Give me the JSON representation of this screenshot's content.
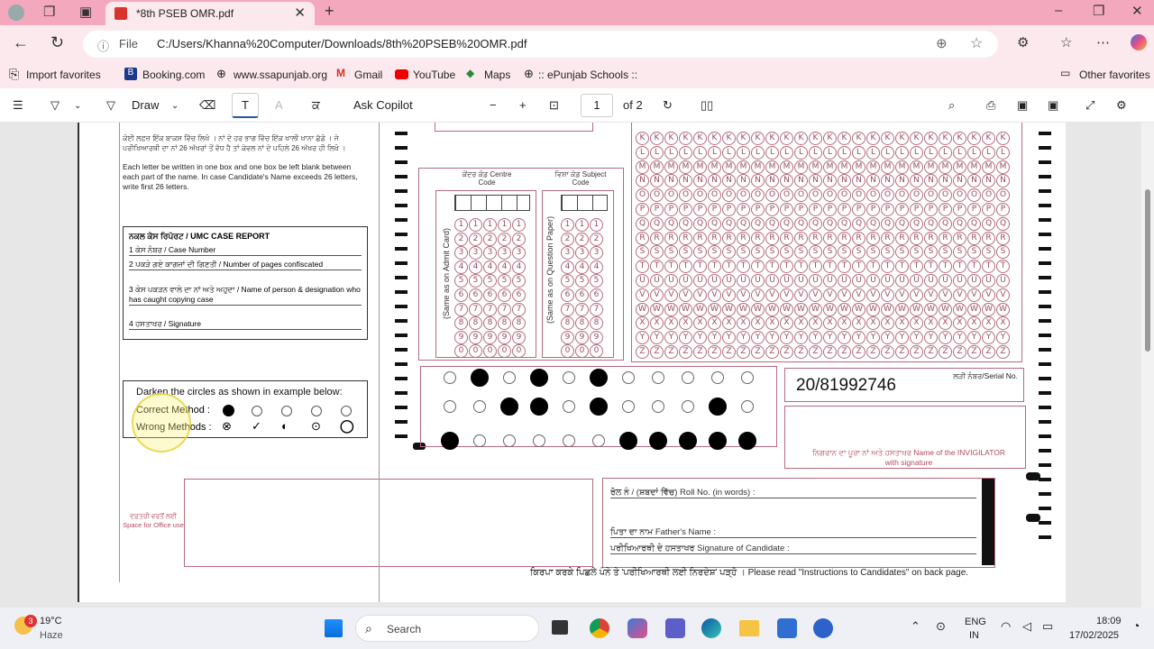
{
  "browser": {
    "tab_title": "*8th PSEB OMR.pdf",
    "url_label": "File",
    "url": "C:/Users/Khanna%20Computer/Downloads/8th%20PSEB%20OMR.pdf"
  },
  "bookmarks": [
    "Import favorites",
    "Booking.com",
    "www.ssapunjab.org",
    "Gmail",
    "YouTube",
    "Maps",
    ":: ePunjab Schools ::"
  ],
  "other_favorites": "Other favorites",
  "pdf_toolbar": {
    "draw": "Draw",
    "ask_copilot": "Ask Copilot",
    "page": "1",
    "of_pages": "of 2"
  },
  "omr": {
    "instr1": "ਕੋਈ ਲਫ਼ਜ਼ ਇੱਕ ਬਾਕਸ ਵਿੱਚ ਲਿਖੋ । ਨਾਂ ਦੇ ਹਰ ਭਾਗ ਵਿੱਚ ਇੱਕ ਖਾਲੀ ਖਾਨਾ ਛੱਡੋ । ਜੇ ਪਰੀਖਿਆਰਥੀ ਦਾ ਨਾਂ 26 ਅੱਖਰਾਂ ਤੋਂ ਵੱਧ ਹੈ ਤਾਂ ਕੇਵਲ ਨਾਂ ਦੇ ਪਹਿਲੇ 26 ਅੱਖਰ ਹੀ ਲਿਖੋ ।",
    "instr2": "Each letter be written in one box and one box be left blank between each part of the name. In case Candidate's Name exceeds 26 letters, write first 26 letters.",
    "umc_title": "ਨਕਲ ਕੇਸ ਰਿਪੋਰਟ / UMC CASE REPORT",
    "umc_items": [
      "1  ਕੇਸ ਨੰਬਰ / Case Number",
      "2  ਪਕੜੇ ਗਏ ਕਾਗਜ਼ਾਂ ਦੀ ਗਿਣਤੀ / Number of pages confiscated",
      "3  ਕੇਸ ਪਕੜਨ ਵਾਲੇ ਦਾ ਨਾਂ ਅਤੇ ਅਹੁਦਾ / Name of person & designation who has caught copying case",
      "4  ਹਸਤਾਖਰ / Signature"
    ],
    "darken_title": "Darken the circles as shown in example below:",
    "correct": "Correct Method :",
    "wrong": "Wrong Methods :",
    "centre_code": "ਕੇਂਦਰ ਕੋਡ Centre Code",
    "subject_code": "ਵਿਸ਼ਾ ਕੋਡ Subject Code",
    "admit_card": "(Same as on Admit Card)",
    "question_paper": "(Same as on Question Paper)",
    "serial_no": "20/81992746",
    "serial_label": "ਲੜੀ ਨੰਬਰ/Serial No.",
    "invigilator": "ਨਿਗਰਾਨ ਦਾ ਪੂਰਾ ਨਾਂ ਅਤੇ ਹਸਤਾਖਰ Name of the INVIGILATOR with signature",
    "office_use": "ਦਫ਼ਤਰੀ ਵਰਤੋਂ ਲਈ Space for Office use",
    "roll_words": "ਰੋਲ ਨੰ / (ਸ਼ਬਦਾਂ ਵਿੱਚ) Roll No. (in words) :",
    "father": "ਪਿਤਾ ਦਾ ਨਾਮ Father's Name :",
    "signature": "ਪਰੀਖਿਆਰਥੀ ਦੇ ਹਸਤਾਖਰ Signature of Candidate :",
    "footer": "ਕਿਰਪਾ ਕਰਕੇ ਪਿਛਲੇ ਪੰਨੇ ਤੇ 'ਪਰੀਖਿਆਰਥੀ ਲਈ ਨਿਰਦੇਸ਼' ਪੜ੍ਹੋ । Please read \"Instructions to Candidates\" on back page.",
    "letters": [
      "K",
      "L",
      "M",
      "N",
      "O",
      "P",
      "Q",
      "R",
      "S",
      "T",
      "U",
      "V",
      "W",
      "X",
      "Y",
      "Z"
    ],
    "digits": [
      "1",
      "2",
      "3",
      "4",
      "5",
      "6",
      "7",
      "8",
      "9",
      "0"
    ]
  },
  "taskbar": {
    "temp": "19°C",
    "weather": "Haze",
    "weather_badge": "3",
    "search": "Search",
    "lang1": "ENG",
    "lang2": "IN",
    "time": "18:09",
    "date": "17/02/2025"
  }
}
